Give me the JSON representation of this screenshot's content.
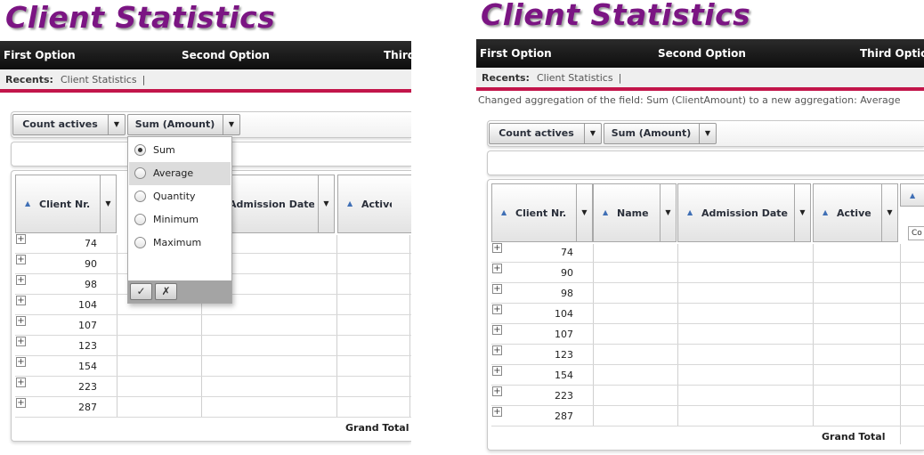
{
  "title": "Client Statistics",
  "nav": {
    "first": "First Option",
    "second": "Second Option",
    "third": "Third Option"
  },
  "recents": {
    "label": "Recents:",
    "link": "Client Statistics",
    "separator": "|"
  },
  "status_message": "Changed aggregation of the field: Sum (ClientAmount) to a new aggregation: Average",
  "toolbar": {
    "count_actives": "Count actives",
    "sum_amount": "Sum (Amount)"
  },
  "columns": {
    "client_nr": "Client Nr.",
    "name": "Name",
    "admission_date": "Admission Date",
    "admission_date_clipped": "Admission Date",
    "active": "Active",
    "clipped_header": "Co"
  },
  "rows": [
    "74",
    "90",
    "98",
    "104",
    "107",
    "123",
    "154",
    "223",
    "287"
  ],
  "grand_total": "Grand Total",
  "aggregation_menu": {
    "options": [
      "Sum",
      "Average",
      "Quantity",
      "Minimum",
      "Maximum"
    ],
    "selected": "Sum",
    "highlighted": "Average",
    "ok": "✓",
    "cancel": "✗"
  },
  "colors": {
    "title": "#7b1583",
    "accent": "#c2154a",
    "nav_bg": "#111111"
  },
  "icons": {
    "sort": "sort-ascending-icon",
    "menu": "dropdown-arrow-icon",
    "expand": "plus-box-icon"
  }
}
